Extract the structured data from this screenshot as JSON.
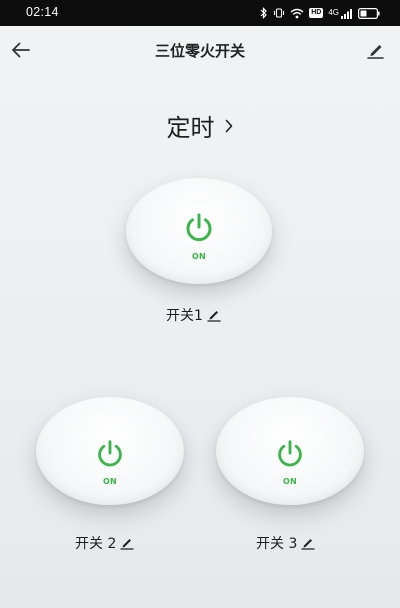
{
  "status_bar": {
    "time": "02:14",
    "icons": [
      "bluetooth-icon",
      "vibrate-icon",
      "wifi-icon",
      "hd-badge",
      "signal-icon",
      "battery-icon"
    ],
    "hd_label": "HD",
    "network_label": "4G"
  },
  "header": {
    "title": "三位零火开关",
    "back_icon": "arrow-left-icon",
    "edit_icon": "pencil-icon"
  },
  "timer": {
    "label": "定时",
    "icon": "chevron-right-icon"
  },
  "switches": [
    {
      "name": "开关1",
      "state": "ON"
    },
    {
      "name": "开关 2",
      "state": "ON"
    },
    {
      "name": "开关 3",
      "state": "ON"
    }
  ],
  "colors": {
    "accent": "#3bb54a",
    "status_bar_bg": "#0d0d0d",
    "background": "#eceef1"
  }
}
